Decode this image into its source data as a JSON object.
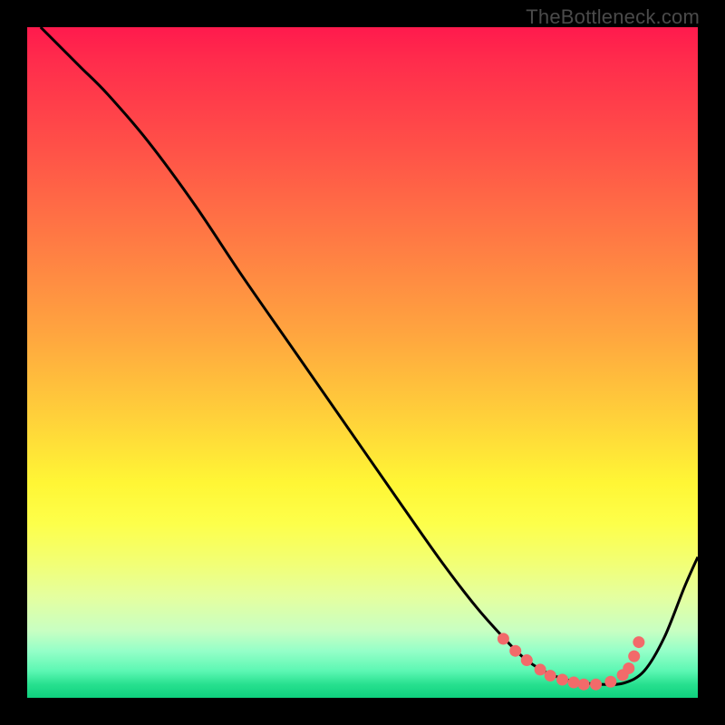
{
  "watermark": "TheBottleneck.com",
  "chart_data": {
    "type": "line",
    "title": "",
    "xlabel": "",
    "ylabel": "",
    "xlim": [
      0,
      100
    ],
    "ylim": [
      0,
      100
    ],
    "series": [
      {
        "name": "bottleneck-curve",
        "x": [
          2,
          5,
          8,
          12,
          18,
          25,
          32,
          40,
          48,
          56,
          62,
          67,
          71,
          74,
          77,
          80,
          83,
          86,
          89,
          92,
          95,
          98,
          100
        ],
        "y": [
          100,
          97,
          94,
          90,
          83,
          73.5,
          63,
          51.5,
          40,
          28.5,
          20,
          13.5,
          9,
          6,
          4,
          2.8,
          2.2,
          2,
          2.2,
          4,
          9,
          16.5,
          21
        ]
      }
    ],
    "markers": {
      "name": "optimal-range-dots",
      "color": "#f26a6a",
      "x": [
        71,
        72.8,
        74.5,
        76.5,
        78,
        79.8,
        81.5,
        83,
        84.8,
        87,
        88.8,
        89.7,
        90.5,
        91.2
      ],
      "y": [
        8.8,
        7.0,
        5.6,
        4.2,
        3.3,
        2.7,
        2.3,
        2.0,
        2.0,
        2.4,
        3.4,
        4.4,
        6.2,
        8.3
      ]
    },
    "background_gradient": {
      "orientation": "vertical",
      "stops": [
        {
          "pos": 0.0,
          "color": "#ff1a4d"
        },
        {
          "pos": 0.18,
          "color": "#ff5148"
        },
        {
          "pos": 0.46,
          "color": "#ffa63f"
        },
        {
          "pos": 0.68,
          "color": "#fff635"
        },
        {
          "pos": 0.85,
          "color": "#e4ffa0"
        },
        {
          "pos": 0.96,
          "color": "#5cf7b3"
        },
        {
          "pos": 1.0,
          "color": "#0fd17e"
        }
      ]
    }
  }
}
